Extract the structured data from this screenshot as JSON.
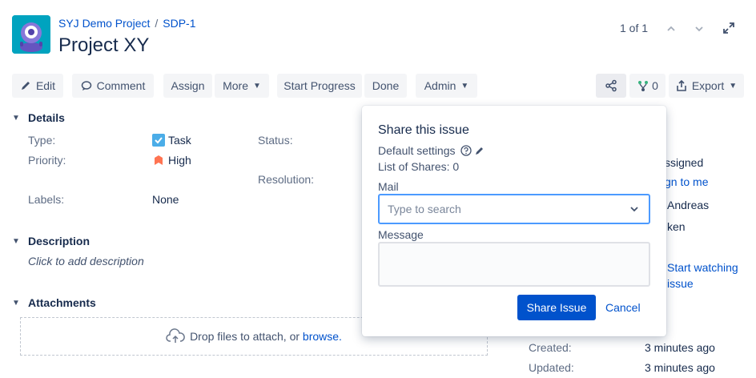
{
  "header": {
    "project_link": "SYJ Demo Project",
    "issue_key": "SDP-1",
    "title": "Project XY",
    "pager_text": "1 of 1"
  },
  "toolbar": {
    "edit": "Edit",
    "comment": "Comment",
    "assign": "Assign",
    "more": "More",
    "start_progress": "Start Progress",
    "done": "Done",
    "admin": "Admin",
    "branch_count": "0",
    "export": "Export"
  },
  "details": {
    "section_title": "Details",
    "type_label": "Type:",
    "type_value": "Task",
    "priority_label": "Priority:",
    "priority_value": "High",
    "labels_label": "Labels:",
    "labels_value": "None",
    "status_label": "Status:",
    "resolution_label": "Resolution:"
  },
  "description": {
    "section_title": "Description",
    "placeholder": "Click to add description"
  },
  "attachments": {
    "section_title": "Attachments",
    "drop_text": "Drop files to attach, or",
    "browse_link": "browse."
  },
  "people": {
    "assignee_partial": "ssigned",
    "assign_to_me_partial": "gn to me",
    "reporter_partial": "Andreas",
    "votes_partial": "ken",
    "watch_line1": "Start watching",
    "watch_line2": "issue"
  },
  "dates": {
    "created_label": "Created:",
    "created_value": "3 minutes ago",
    "updated_label": "Updated:",
    "updated_value": "3 minutes ago"
  },
  "share_popup": {
    "title": "Share this issue",
    "default_settings": "Default settings",
    "list_of_shares": "List of Shares: 0",
    "mail_label": "Mail",
    "mail_placeholder": "Type to search",
    "message_label": "Message",
    "share_button": "Share Issue",
    "cancel_link": "Cancel"
  },
  "colors": {
    "brand_blue": "#0052cc",
    "focus_border": "#4c9aff",
    "priority_high": "#ff7452",
    "task_blue": "#4bade8"
  }
}
